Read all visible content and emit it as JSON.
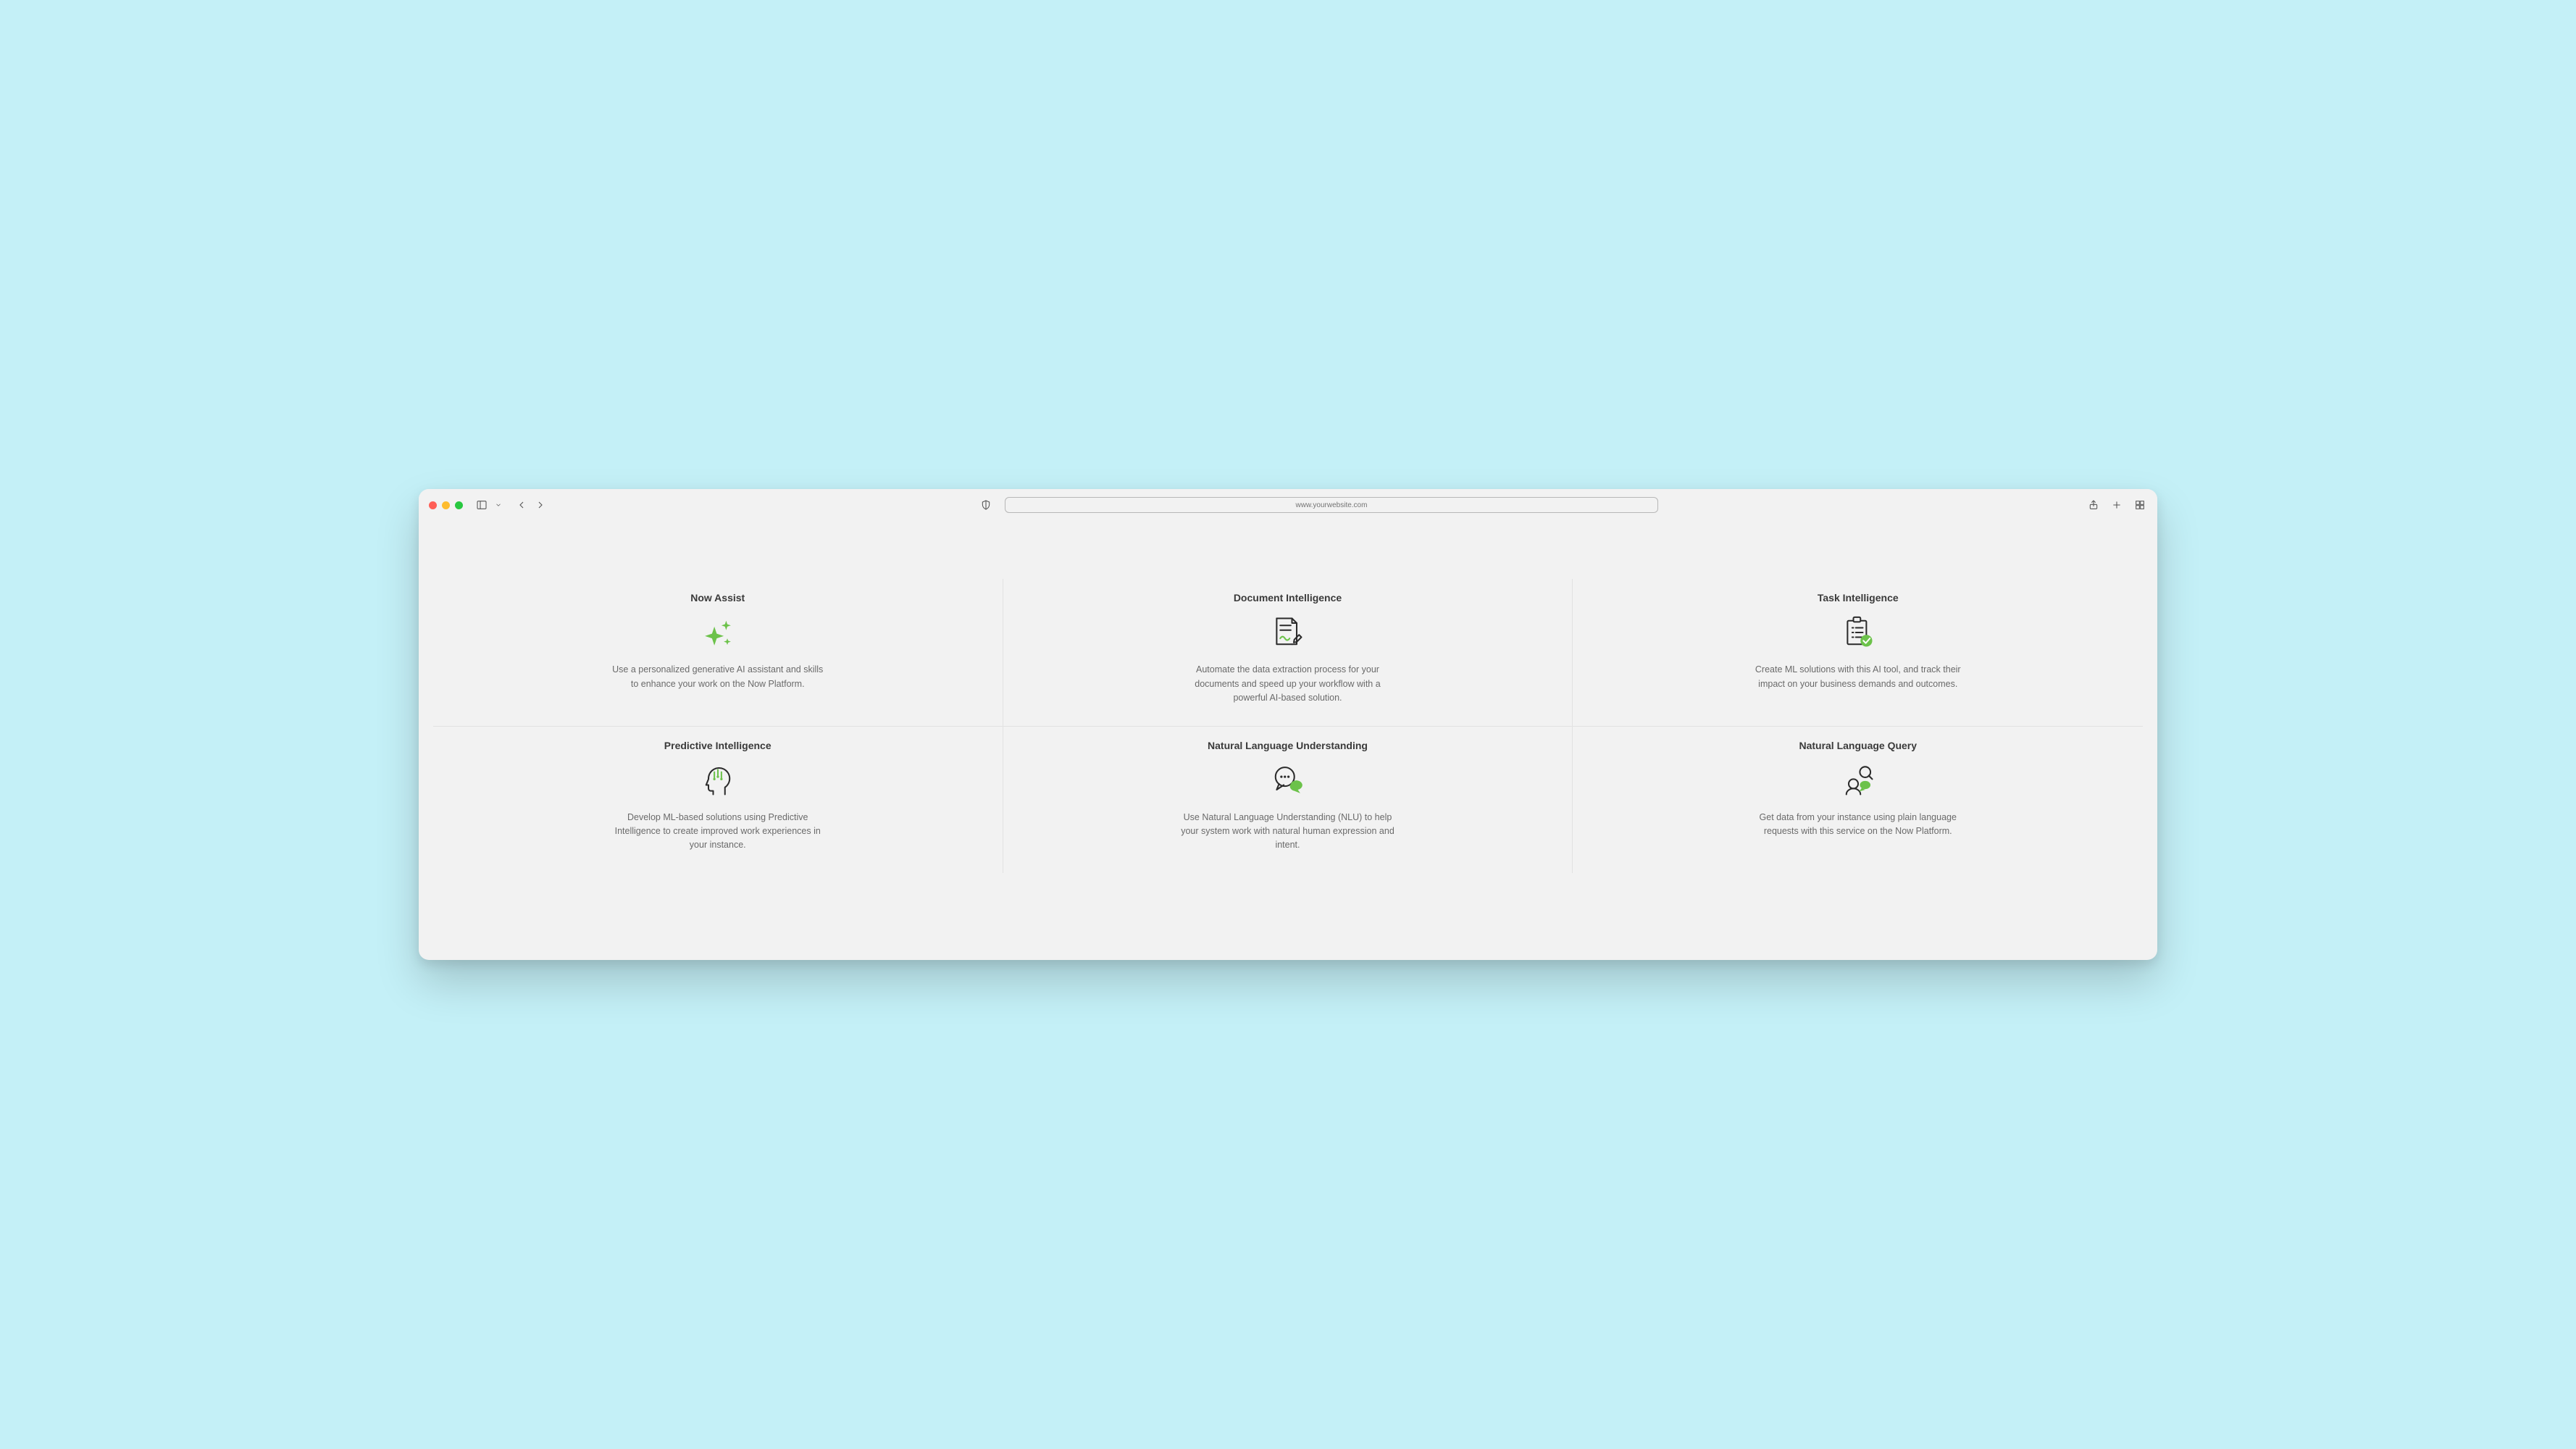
{
  "browser": {
    "url": "www.yourwebsite.com"
  },
  "cards": [
    {
      "title": "Now Assist",
      "icon": "sparkles-icon",
      "description": "Use a personalized generative AI assistant and skills to enhance your work on the Now Platform."
    },
    {
      "title": "Document Intelligence",
      "icon": "document-signature-icon",
      "description": "Automate the data extraction process for your documents and speed up your workflow with a powerful AI-based solution."
    },
    {
      "title": "Task Intelligence",
      "icon": "clipboard-check-icon",
      "description": "Create ML solutions with this AI tool, and track their impact on your business demands and outcomes."
    },
    {
      "title": "Predictive Intelligence",
      "icon": "head-circuit-icon",
      "description": "Develop ML-based solutions using Predictive Intelligence to create improved work experiences in your instance."
    },
    {
      "title": "Natural Language Understanding",
      "icon": "speech-bubble-icon",
      "description": "Use Natural Language Understanding (NLU) to help your system work with natural human expression and intent."
    },
    {
      "title": "Natural Language Query",
      "icon": "person-search-chat-icon",
      "description": "Get data from your instance using plain language requests with this service on the Now Platform."
    }
  ],
  "colors": {
    "accent_green": "#6cc24a",
    "icon_stroke": "#2b2b2b"
  }
}
